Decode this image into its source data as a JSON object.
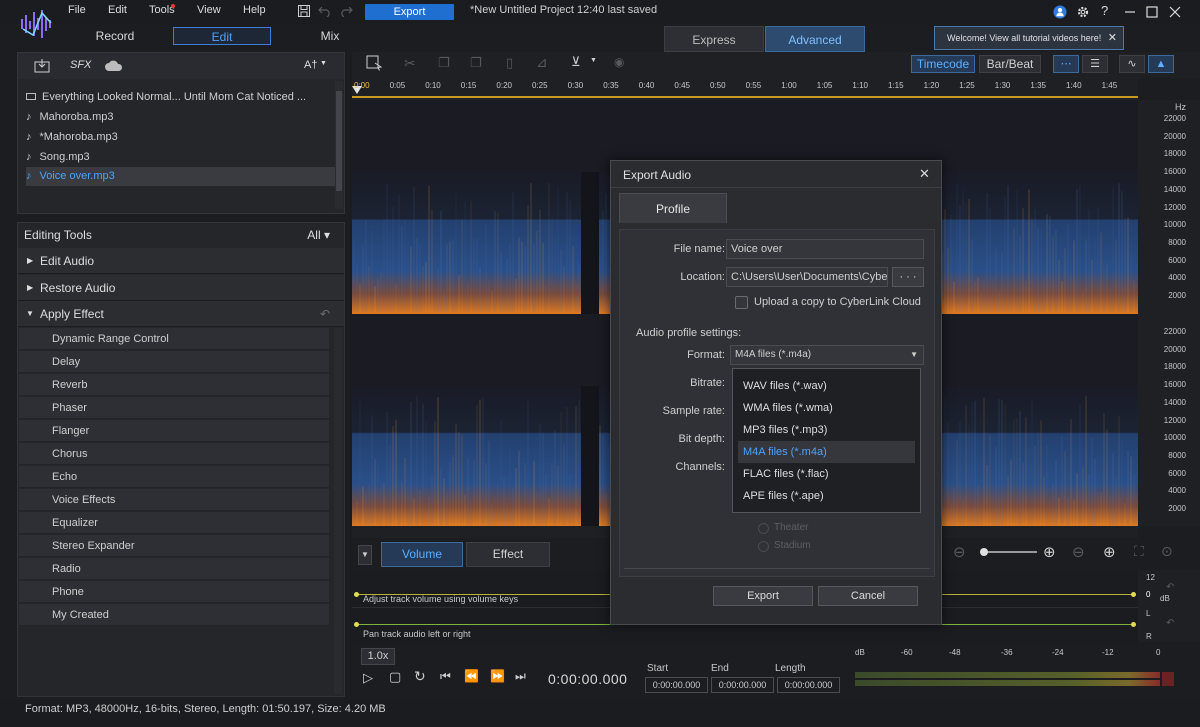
{
  "menubar": {
    "items": [
      "File",
      "Edit",
      "Tools",
      "View",
      "Help"
    ],
    "export_label": "Export",
    "project_title": "*New Untitled Project 12:40 last saved"
  },
  "modes": {
    "record": "Record",
    "edit": "Edit",
    "mix": "Mix"
  },
  "view_tabs": {
    "express": "Express",
    "advanced": "Advanced"
  },
  "tooltip": "Welcome! View all tutorial videos here!",
  "library": {
    "toolbar": {
      "sfx": "SFX",
      "text": "A†"
    },
    "items": [
      {
        "label": "Everything Looked Normal... Until Mom Cat Noticed ...",
        "icon": "video-icon"
      },
      {
        "label": "Mahoroba.mp3",
        "icon": "music-note-icon"
      },
      {
        "label": "*Mahoroba.mp3",
        "icon": "music-note-icon"
      },
      {
        "label": "Song.mp3",
        "icon": "music-note-icon"
      },
      {
        "label": "Voice over.mp3",
        "icon": "music-note-icon",
        "selected": true
      }
    ]
  },
  "editing_tools": {
    "title": "Editing Tools",
    "filter": "All",
    "sections": [
      "Edit Audio",
      "Restore Audio",
      "Apply Effect"
    ],
    "effects": [
      "Dynamic Range Control",
      "Delay",
      "Reverb",
      "Phaser",
      "Flanger",
      "Chorus",
      "Echo",
      "Voice Effects",
      "Equalizer",
      "Stereo Expander",
      "Radio",
      "Phone",
      "My Created"
    ]
  },
  "status": "Format: MP3, 48000Hz, 16-bits, Stereo, Length: 01:50.197, Size: 4.20 MB",
  "timeline": {
    "timecode_label": "Timecode",
    "barbeat_label": "Bar/Beat",
    "ticks": [
      "0:00",
      "0:05",
      "0:10",
      "0:15",
      "0:20",
      "0:25",
      "0:30",
      "0:35",
      "0:40",
      "0:45",
      "0:50",
      "0:55",
      "1:00",
      "1:05",
      "1:10",
      "1:15",
      "1:20",
      "1:25",
      "1:30",
      "1:35",
      "1:40",
      "1:45"
    ],
    "hz_unit": "Hz",
    "hz_labels_top": [
      "22000",
      "20000",
      "18000",
      "16000",
      "14000",
      "12000",
      "10000",
      "8000",
      "6000",
      "4000",
      "2000"
    ],
    "hz_labels_bottom": [
      "22000",
      "20000",
      "18000",
      "16000",
      "14000",
      "12000",
      "10000",
      "8000",
      "6000",
      "4000",
      "2000"
    ]
  },
  "bottom_tabs": {
    "volume": "Volume",
    "effect": "Effect"
  },
  "envelope": {
    "volume_hint": "Adjust track volume using volume keys",
    "pan_hint": "Pan track audio left or right",
    "db_labels": [
      "12",
      "0",
      "dB",
      "L",
      "R"
    ]
  },
  "transport": {
    "speed": "1.0x",
    "time": "0:00:00.000",
    "start_label": "Start",
    "end_label": "End",
    "length_label": "Length",
    "start": "0:00:00.000",
    "end": "0:00:00.000",
    "length": "0:00:00.000",
    "meter_labels": [
      "dB",
      "-60",
      "-48",
      "-36",
      "-24",
      "-12",
      "0"
    ]
  },
  "dialog": {
    "title": "Export Audio",
    "tab": "Profile",
    "file_name_label": "File name:",
    "file_name": "Voice over",
    "location_label": "Location:",
    "location": "C:\\Users\\User\\Documents\\Cyberli...",
    "browse": "· · ·",
    "upload_label": "Upload a copy to CyberLink Cloud",
    "settings_label": "Audio profile settings:",
    "format_label": "Format:",
    "format_value": "M4A files (*.m4a)",
    "bitrate_label": "Bitrate:",
    "sample_rate_label": "Sample rate:",
    "bit_depth_label": "Bit depth:",
    "channels_label": "Channels:",
    "channel_options": [
      "Theater",
      "Stadium"
    ],
    "export_button": "Export",
    "cancel_button": "Cancel"
  },
  "format_dropdown": {
    "options": [
      "WAV files (*.wav)",
      "WMA files (*.wma)",
      "MP3 files (*.mp3)",
      "M4A files (*.m4a)",
      "FLAC files (*.flac)",
      "APE files (*.ape)"
    ],
    "selected": "M4A files (*.m4a)"
  },
  "colors": {
    "accent": "#1f6fd1",
    "selected_text": "#4aa3ff",
    "spectrum_low": "#e07a1f",
    "spectrum_mid": "#2c4f8f"
  }
}
